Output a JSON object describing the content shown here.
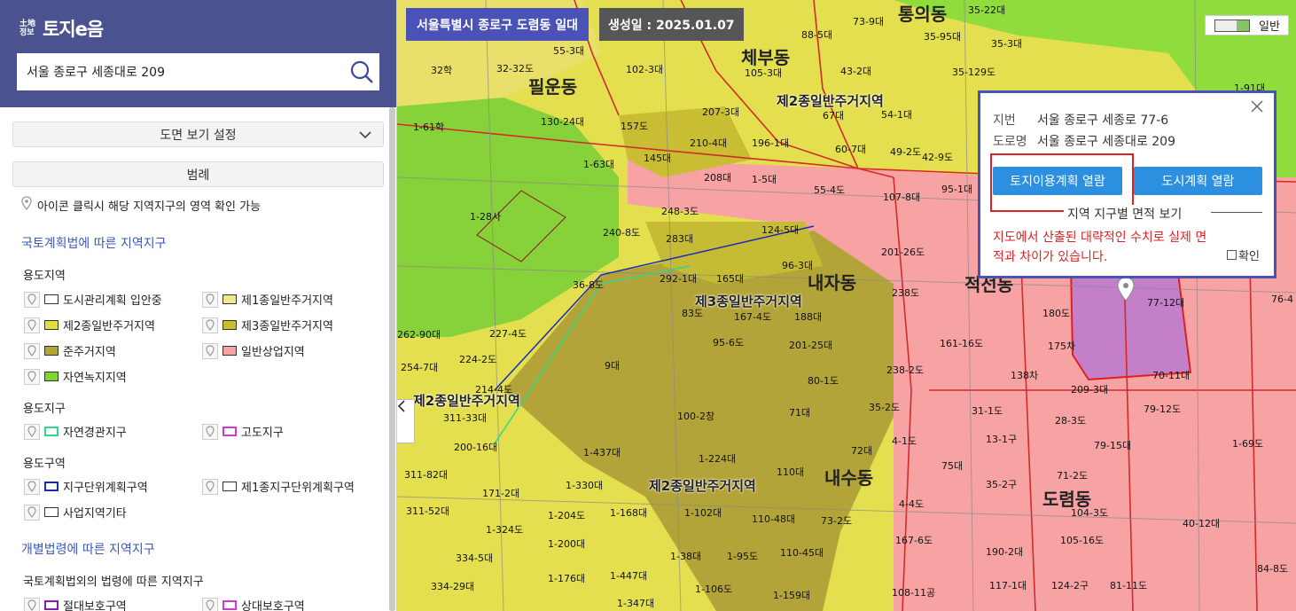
{
  "app": {
    "logo_small": "土地\n정보",
    "logo_text": "토지e음"
  },
  "search": {
    "value": "서울 종로구 세종대로 209"
  },
  "sidebar": {
    "view_setting": "도면 보기 설정",
    "legend": "범례",
    "hint": "아이콘 클릭시 해당 지역지구의 영역 확인 가능",
    "section1": "국토계획법에 따른 지역지구",
    "group_yongdo_jiyeok": "용도지역",
    "group_yongdo_jigu": "용도지구",
    "group_yongdo_guyeok": "용도구역",
    "section2": "개별법령에 따른 지역지구",
    "group_other": "국토계획법외의 법령에 따른 지역지구",
    "legend_items": [
      {
        "label": "도시관리계획 입안중",
        "color": "#ffffff",
        "border": "#333333"
      },
      {
        "label": "제1종일반주거지역",
        "color": "#efe98a",
        "border": "#333333"
      },
      {
        "label": "제2종일반주거지역",
        "color": "#e3de3a",
        "border": "#333333"
      },
      {
        "label": "제3종일반주거지역",
        "color": "#c9bf2a",
        "border": "#333333"
      },
      {
        "label": "준주거지역",
        "color": "#b3a43a",
        "border": "#333333"
      },
      {
        "label": "일반상업지역",
        "color": "#f7a3a3",
        "border": "#333333"
      },
      {
        "label": "자연녹지지역",
        "color": "#7dd634",
        "border": "#333333"
      },
      {
        "label": "자연경관지구",
        "color": "#ffffff",
        "border": "#2fd88a"
      },
      {
        "label": "고도지구",
        "color": "#ffffff",
        "border": "#d03ad0"
      },
      {
        "label": "지구단위계획구역",
        "color": "#ffffff",
        "border": "#1a2ab8"
      },
      {
        "label": "제1종지구단위계획구역",
        "color": "#ffffff",
        "border": "#333333"
      },
      {
        "label": "사업지역기타",
        "color": "#ffffff",
        "border": "#333333"
      },
      {
        "label": "절대보호구역",
        "color": "#ffffff",
        "border": "#8a1ab8"
      },
      {
        "label": "상대보호구역",
        "color": "#ffffff",
        "border": "#d03ad0"
      }
    ]
  },
  "map": {
    "location": "서울특별시 종로구 도렴동 일대",
    "created": "생성일 : 2025.01.07",
    "basemap": "일반",
    "dong_labels": [
      "필운동",
      "체부동",
      "통의동",
      "내자동",
      "내수동",
      "도렴동",
      "적선동"
    ],
    "zone_labels": [
      "제2종일반주거지역",
      "제3종일반주거지역",
      "제2종일반주거지역",
      "제2종일반주거지역"
    ],
    "parcel_labels": [
      "55-3대",
      "32-32도",
      "102-3대",
      "32학",
      "130-24대",
      "1-61학",
      "157도",
      "145대",
      "1-63대",
      "208대",
      "210-4대",
      "207-3대",
      "1-28사",
      "240-8도",
      "248-3도",
      "283대",
      "124-5대",
      "55-4도",
      "1-5대",
      "292-1대",
      "165대",
      "96-3대",
      "36-8도",
      "83도",
      "167-4도",
      "188대",
      "227-4도",
      "95-6도",
      "201-25대",
      "224-2도",
      "9대",
      "262-90대",
      "254-7대",
      "214-4도",
      "80-1도",
      "311-33대",
      "71대",
      "100-2창",
      "35-2도",
      "200-16대",
      "1-437대",
      "4-1도",
      "72대",
      "311-82대",
      "1-224대",
      "110대",
      "1-330대",
      "171-2대",
      "311-52대",
      "1-168대",
      "1-102대",
      "110-48대",
      "73-2도",
      "1-204도",
      "1-324도",
      "1-200대",
      "1-38대",
      "1-95도",
      "110-45대",
      "334-5대",
      "1-447대",
      "1-176대",
      "334-29대",
      "1-106도",
      "1-159대",
      "1-347대",
      "88-5대",
      "73-9대",
      "35-22대",
      "35-95대",
      "35-3대",
      "35-129도",
      "43-2대",
      "67대",
      "54-1대",
      "60-7대",
      "105-3대",
      "196-1대",
      "49-2도",
      "42-9도",
      "107-8대",
      "95-1대",
      "201-26도",
      "238도",
      "161-16도",
      "180도",
      "175차",
      "138차",
      "238-2도",
      "31-1도",
      "13-1구",
      "28-3도",
      "75대",
      "35-2구",
      "71-2도",
      "4-4도",
      "167-6도",
      "190-2대",
      "117-1대",
      "108-11공",
      "124-2구",
      "81-11도",
      "104-3도",
      "105-16도",
      "79-15대",
      "79-12도",
      "40-12대",
      "1-69도",
      "77-12대",
      "76-4",
      "84-8도",
      "1-91대",
      "70-11대",
      "209-3대"
    ]
  },
  "popup": {
    "jibun_label": "지번",
    "jibun_value": "서울 종로구 세종로 77-6",
    "road_label": "도로명",
    "road_value": "서울 종로구 세종대로 209",
    "btn_landuse": "토지이용계획 열람",
    "btn_cityplan": "도시계획 열람",
    "area_view": "지역 지구별 면적 보기",
    "warning": "지도에서 산출된 대략적인 수치로 실제 면적과 차이가 있습니다.",
    "confirm": "확인"
  },
  "colors": {
    "header": "#4a5290",
    "accent": "#2d8fe0",
    "warn": "#e02020"
  }
}
